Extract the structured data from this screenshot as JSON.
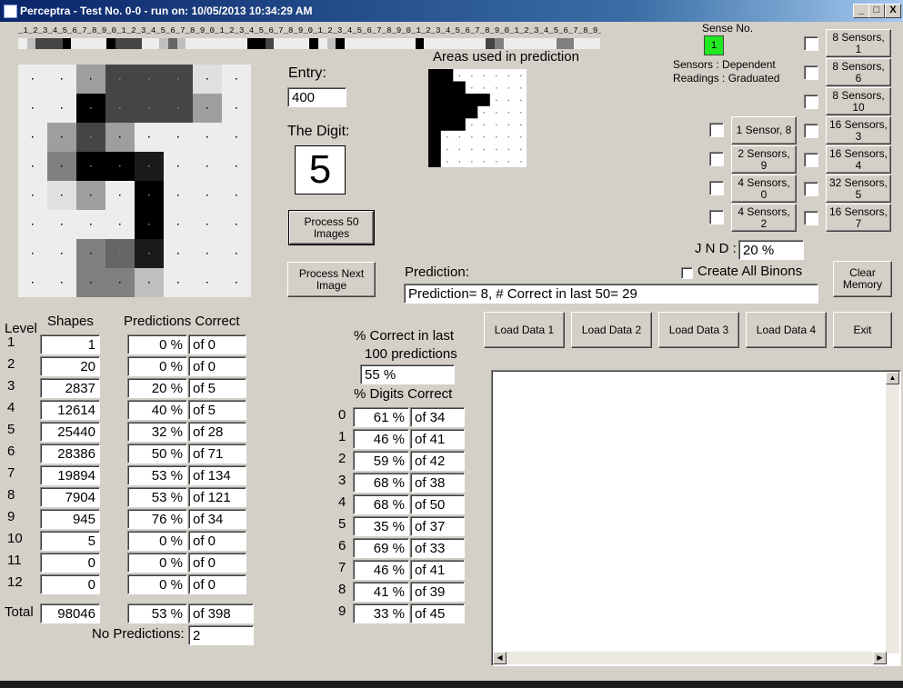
{
  "window": {
    "title": "Perceptra - Test No. 0-0 - run on: 10/05/2013  10:34:29 AM",
    "min": "_",
    "max": "□",
    "close": "X"
  },
  "ruler": "_1_2_3_4_5_6_7_8_9_0_1_2_3_4_5_6_7_8_9_0_1_2_3_4_5_6_7_8_9_0_1_2_3_4_5_6_7_8_9_0_1_2_3_4_5_6_7_8_9_0_1_2_3_4_5_6_7_8_9_0_1_2_3_4_5_6_7_8_9_0_1_2_3_4",
  "sensor_strip": [
    0.93,
    0.75,
    0.27,
    0.27,
    0.27,
    0.0,
    0.93,
    0.93,
    0.93,
    0.93,
    0.0,
    0.27,
    0.27,
    0.27,
    0.93,
    0.93,
    0.75,
    0.4,
    0.75,
    0.93,
    0.93,
    0.93,
    0.93,
    0.93,
    0.93,
    0.93,
    0.0,
    0.0,
    0.27,
    0.93,
    0.93,
    0.93,
    0.93,
    0.0,
    0.93,
    0.75,
    0.0,
    0.93,
    0.93,
    0.93,
    0.93,
    0.93,
    0.93,
    0.93,
    0.93,
    0.0,
    0.93,
    0.93,
    0.93,
    0.93,
    0.93,
    0.93,
    0.93,
    0.27,
    0.5,
    0.93,
    0.93,
    0.93,
    0.93,
    0.93,
    0.93,
    0.5,
    0.5,
    0.93,
    0.93,
    0.93
  ],
  "digit_image": [
    [
      0.93,
      0.93,
      0.62,
      0.27,
      0.27,
      0.27,
      0.88,
      0.93
    ],
    [
      0.93,
      0.93,
      0.0,
      0.27,
      0.27,
      0.27,
      0.62,
      0.93
    ],
    [
      0.93,
      0.62,
      0.27,
      0.62,
      0.93,
      0.93,
      0.93,
      0.93
    ],
    [
      0.93,
      0.5,
      0.0,
      0.0,
      0.1,
      0.93,
      0.93,
      0.93
    ],
    [
      0.93,
      0.88,
      0.62,
      0.93,
      0.0,
      0.93,
      0.93,
      0.93
    ],
    [
      0.93,
      0.93,
      0.93,
      0.93,
      0.0,
      0.93,
      0.93,
      0.93
    ],
    [
      0.93,
      0.93,
      0.5,
      0.4,
      0.1,
      0.93,
      0.93,
      0.93
    ],
    [
      0.93,
      0.93,
      0.5,
      0.5,
      0.75,
      0.93,
      0.93,
      0.93
    ]
  ],
  "areas": [
    [
      1,
      1,
      0,
      0,
      0,
      0,
      0,
      0
    ],
    [
      1,
      1,
      1,
      0,
      0,
      0,
      0,
      0
    ],
    [
      1,
      1,
      1,
      1,
      1,
      0,
      0,
      0
    ],
    [
      1,
      1,
      1,
      1,
      0,
      0,
      0,
      0
    ],
    [
      1,
      1,
      1,
      0,
      0,
      0,
      0,
      0
    ],
    [
      1,
      0,
      0,
      0,
      0,
      0,
      0,
      0
    ],
    [
      1,
      0,
      0,
      0,
      0,
      0,
      0,
      0
    ],
    [
      1,
      0,
      0,
      0,
      0,
      0,
      0,
      0
    ]
  ],
  "labels": {
    "entry": "Entry:",
    "the_digit": "The Digit:",
    "areas_used": "Areas used in prediction",
    "sense_no": "Sense No.",
    "sensors": "Sensors   :  Dependent",
    "readings": "Readings :  Graduated",
    "jnd": "J N D :",
    "prediction": "Prediction:",
    "create_all": "Create All Binons",
    "level": "Level",
    "shapes": "Shapes",
    "pred_correct": "Predictions Correct",
    "pct_last_1": "% Correct in last",
    "pct_last_2": "100 predictions",
    "digits_correct": "% Digits Correct",
    "total": "Total",
    "no_predictions": "No Predictions:"
  },
  "values": {
    "entry": "400",
    "digit": "5",
    "sense": "1",
    "jnd": "20 %",
    "prediction": "Prediction= 8, # Correct in last 50= 29",
    "pct_last_100": "55 %",
    "total_shapes": "98046",
    "total_pct": "53 %",
    "total_of": "of 398",
    "no_predictions": "2"
  },
  "buttons": {
    "process50": "Process 50 Images",
    "process_next": "Process Next Image",
    "clear_memory": "Clear Memory",
    "load1": "Load Data 1",
    "load2": "Load Data 2",
    "load3": "Load Data 3",
    "load4": "Load Data 4",
    "exit": "Exit"
  },
  "sensor_buttons_left": [
    "1 Sensor, 8",
    "2 Sensors, 9",
    "4 Sensors, 0",
    "4 Sensors, 2"
  ],
  "sensor_buttons_right": [
    "8 Sensors, 1",
    "8 Sensors, 6",
    "8 Sensors, 10",
    "16 Sensors, 3",
    "16 Sensors, 4",
    "32 Sensors, 5",
    "16 Sensors, 7"
  ],
  "levels": [
    {
      "level": "1",
      "shapes": "1",
      "pct": "0 %",
      "of": "of 0"
    },
    {
      "level": "2",
      "shapes": "20",
      "pct": "0 %",
      "of": "of 0"
    },
    {
      "level": "3",
      "shapes": "2837",
      "pct": "20 %",
      "of": "of 5"
    },
    {
      "level": "4",
      "shapes": "12614",
      "pct": "40 %",
      "of": "of 5"
    },
    {
      "level": "5",
      "shapes": "25440",
      "pct": "32 %",
      "of": "of 28"
    },
    {
      "level": "6",
      "shapes": "28386",
      "pct": "50 %",
      "of": "of 71"
    },
    {
      "level": "7",
      "shapes": "19894",
      "pct": "53 %",
      "of": "of 134"
    },
    {
      "level": "8",
      "shapes": "7904",
      "pct": "53 %",
      "of": "of 121"
    },
    {
      "level": "9",
      "shapes": "945",
      "pct": "76 %",
      "of": "of 34"
    },
    {
      "level": "10",
      "shapes": "5",
      "pct": "0 %",
      "of": "of 0"
    },
    {
      "level": "11",
      "shapes": "0",
      "pct": "0 %",
      "of": "of 0"
    },
    {
      "level": "12",
      "shapes": "0",
      "pct": "0 %",
      "of": "of 0"
    }
  ],
  "digits": [
    {
      "digit": "0",
      "pct": "61 %",
      "of": "of 34"
    },
    {
      "digit": "1",
      "pct": "46 %",
      "of": "of 41"
    },
    {
      "digit": "2",
      "pct": "59 %",
      "of": "of 42"
    },
    {
      "digit": "3",
      "pct": "68 %",
      "of": "of 38"
    },
    {
      "digit": "4",
      "pct": "68 %",
      "of": "of 50"
    },
    {
      "digit": "5",
      "pct": "35 %",
      "of": "of 37"
    },
    {
      "digit": "6",
      "pct": "69 %",
      "of": "of 33"
    },
    {
      "digit": "7",
      "pct": "46 %",
      "of": "of 41"
    },
    {
      "digit": "8",
      "pct": "41 %",
      "of": "of 39"
    },
    {
      "digit": "9",
      "pct": "33 %",
      "of": "of 45"
    }
  ],
  "colors": {
    "sense_indicator": "#22e822",
    "window_bg": "#d4d0c8",
    "title_bar": "#0a246a"
  }
}
